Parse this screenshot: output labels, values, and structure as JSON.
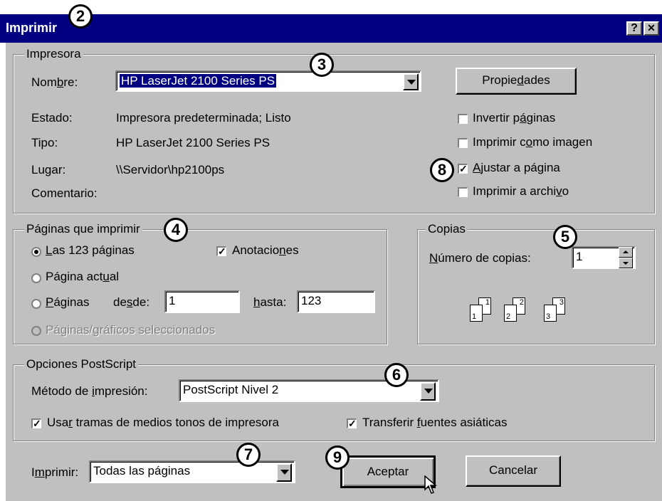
{
  "window": {
    "title": "Imprimir",
    "help": "?",
    "close": "✕"
  },
  "printer": {
    "group_label": "Impresora",
    "name_label": "Nombre:",
    "name_value": "HP LaserJet 2100 Series PS",
    "properties_button": "Propiedades",
    "status_label": "Estado:",
    "status_value": "Impresora predeterminada; Listo",
    "type_label": "Tipo:",
    "type_value": "HP LaserJet 2100 Series PS",
    "where_label": "Lugar:",
    "where_value": "\\\\Servidor\\hp2100ps",
    "comment_label": "Comentario:",
    "options": [
      {
        "label": "Invertir páginas",
        "checked": false
      },
      {
        "label": "Imprimir como imagen",
        "checked": false
      },
      {
        "label": "Ajustar a página",
        "checked": true
      },
      {
        "label": "Imprimir a archivo",
        "checked": false
      }
    ]
  },
  "pages": {
    "group_label": "Páginas que imprimir",
    "all_label": "Las 123 páginas",
    "current_label": "Página actual",
    "range_label": "Páginas",
    "from_label": "desde:",
    "from_value": "1",
    "to_label": "hasta:",
    "to_value": "123",
    "selected_label": "Páginas/gráficos seleccionados",
    "annotations_label": "Anotaciones",
    "annotations_checked": true
  },
  "copies": {
    "group_label": "Copias",
    "count_label": "Número de copias:",
    "count_value": "1",
    "collate_digits": [
      "1",
      "1",
      "2",
      "2",
      "3",
      "3"
    ]
  },
  "postscript": {
    "group_label": "Opciones PostScript",
    "method_label": "Método de impresión:",
    "method_value": "PostScript Nivel 2",
    "halftone_label": "Usar tramas de medios tonos de impresora",
    "halftone_checked": true,
    "asian_fonts_label": "Transferir fuentes asiáticas",
    "asian_fonts_checked": true
  },
  "footer": {
    "print_label": "Imprimir:",
    "print_value": "Todas las páginas",
    "ok_button": "Aceptar",
    "cancel_button": "Cancelar"
  },
  "callouts": [
    "2",
    "3",
    "4",
    "5",
    "6",
    "7",
    "8",
    "9"
  ],
  "colors": {
    "titlebar": "#000080",
    "face": "#c0c0c0",
    "selection": "#000080"
  }
}
